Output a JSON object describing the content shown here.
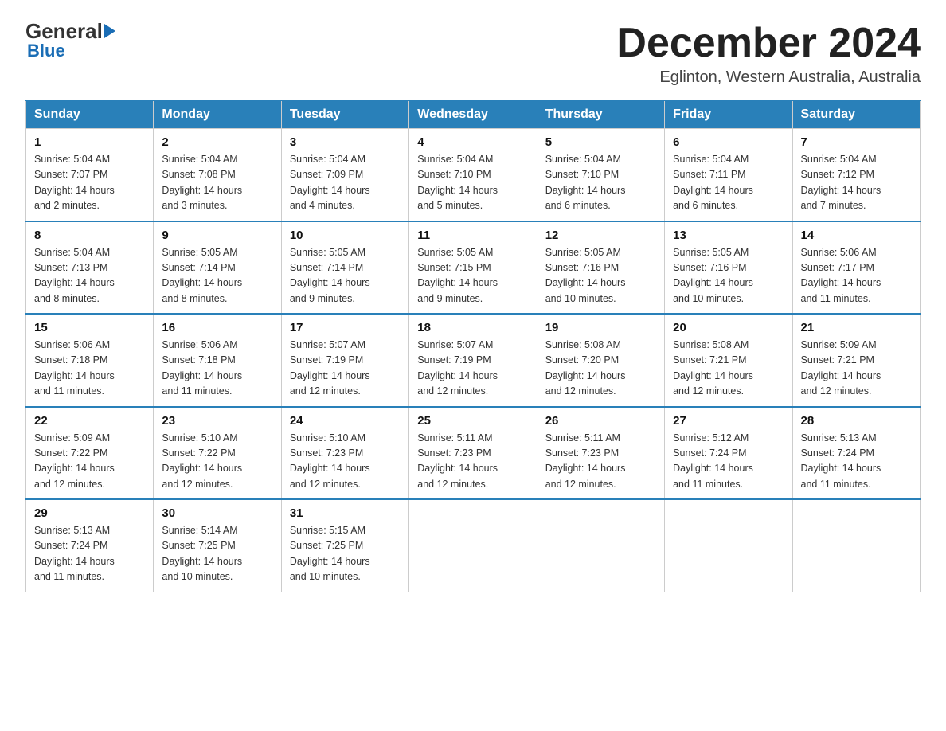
{
  "logo": {
    "general": "General",
    "blue": "Blue"
  },
  "header": {
    "title": "December 2024",
    "subtitle": "Eglinton, Western Australia, Australia"
  },
  "days_of_week": [
    "Sunday",
    "Monday",
    "Tuesday",
    "Wednesday",
    "Thursday",
    "Friday",
    "Saturday"
  ],
  "weeks": [
    [
      {
        "day": "1",
        "sunrise": "5:04 AM",
        "sunset": "7:07 PM",
        "daylight": "14 hours and 2 minutes."
      },
      {
        "day": "2",
        "sunrise": "5:04 AM",
        "sunset": "7:08 PM",
        "daylight": "14 hours and 3 minutes."
      },
      {
        "day": "3",
        "sunrise": "5:04 AM",
        "sunset": "7:09 PM",
        "daylight": "14 hours and 4 minutes."
      },
      {
        "day": "4",
        "sunrise": "5:04 AM",
        "sunset": "7:10 PM",
        "daylight": "14 hours and 5 minutes."
      },
      {
        "day": "5",
        "sunrise": "5:04 AM",
        "sunset": "7:10 PM",
        "daylight": "14 hours and 6 minutes."
      },
      {
        "day": "6",
        "sunrise": "5:04 AM",
        "sunset": "7:11 PM",
        "daylight": "14 hours and 6 minutes."
      },
      {
        "day": "7",
        "sunrise": "5:04 AM",
        "sunset": "7:12 PM",
        "daylight": "14 hours and 7 minutes."
      }
    ],
    [
      {
        "day": "8",
        "sunrise": "5:04 AM",
        "sunset": "7:13 PM",
        "daylight": "14 hours and 8 minutes."
      },
      {
        "day": "9",
        "sunrise": "5:05 AM",
        "sunset": "7:14 PM",
        "daylight": "14 hours and 8 minutes."
      },
      {
        "day": "10",
        "sunrise": "5:05 AM",
        "sunset": "7:14 PM",
        "daylight": "14 hours and 9 minutes."
      },
      {
        "day": "11",
        "sunrise": "5:05 AM",
        "sunset": "7:15 PM",
        "daylight": "14 hours and 9 minutes."
      },
      {
        "day": "12",
        "sunrise": "5:05 AM",
        "sunset": "7:16 PM",
        "daylight": "14 hours and 10 minutes."
      },
      {
        "day": "13",
        "sunrise": "5:05 AM",
        "sunset": "7:16 PM",
        "daylight": "14 hours and 10 minutes."
      },
      {
        "day": "14",
        "sunrise": "5:06 AM",
        "sunset": "7:17 PM",
        "daylight": "14 hours and 11 minutes."
      }
    ],
    [
      {
        "day": "15",
        "sunrise": "5:06 AM",
        "sunset": "7:18 PM",
        "daylight": "14 hours and 11 minutes."
      },
      {
        "day": "16",
        "sunrise": "5:06 AM",
        "sunset": "7:18 PM",
        "daylight": "14 hours and 11 minutes."
      },
      {
        "day": "17",
        "sunrise": "5:07 AM",
        "sunset": "7:19 PM",
        "daylight": "14 hours and 12 minutes."
      },
      {
        "day": "18",
        "sunrise": "5:07 AM",
        "sunset": "7:19 PM",
        "daylight": "14 hours and 12 minutes."
      },
      {
        "day": "19",
        "sunrise": "5:08 AM",
        "sunset": "7:20 PM",
        "daylight": "14 hours and 12 minutes."
      },
      {
        "day": "20",
        "sunrise": "5:08 AM",
        "sunset": "7:21 PM",
        "daylight": "14 hours and 12 minutes."
      },
      {
        "day": "21",
        "sunrise": "5:09 AM",
        "sunset": "7:21 PM",
        "daylight": "14 hours and 12 minutes."
      }
    ],
    [
      {
        "day": "22",
        "sunrise": "5:09 AM",
        "sunset": "7:22 PM",
        "daylight": "14 hours and 12 minutes."
      },
      {
        "day": "23",
        "sunrise": "5:10 AM",
        "sunset": "7:22 PM",
        "daylight": "14 hours and 12 minutes."
      },
      {
        "day": "24",
        "sunrise": "5:10 AM",
        "sunset": "7:23 PM",
        "daylight": "14 hours and 12 minutes."
      },
      {
        "day": "25",
        "sunrise": "5:11 AM",
        "sunset": "7:23 PM",
        "daylight": "14 hours and 12 minutes."
      },
      {
        "day": "26",
        "sunrise": "5:11 AM",
        "sunset": "7:23 PM",
        "daylight": "14 hours and 12 minutes."
      },
      {
        "day": "27",
        "sunrise": "5:12 AM",
        "sunset": "7:24 PM",
        "daylight": "14 hours and 11 minutes."
      },
      {
        "day": "28",
        "sunrise": "5:13 AM",
        "sunset": "7:24 PM",
        "daylight": "14 hours and 11 minutes."
      }
    ],
    [
      {
        "day": "29",
        "sunrise": "5:13 AM",
        "sunset": "7:24 PM",
        "daylight": "14 hours and 11 minutes."
      },
      {
        "day": "30",
        "sunrise": "5:14 AM",
        "sunset": "7:25 PM",
        "daylight": "14 hours and 10 minutes."
      },
      {
        "day": "31",
        "sunrise": "5:15 AM",
        "sunset": "7:25 PM",
        "daylight": "14 hours and 10 minutes."
      },
      null,
      null,
      null,
      null
    ]
  ],
  "labels": {
    "sunrise": "Sunrise:",
    "sunset": "Sunset:",
    "daylight": "Daylight:"
  }
}
